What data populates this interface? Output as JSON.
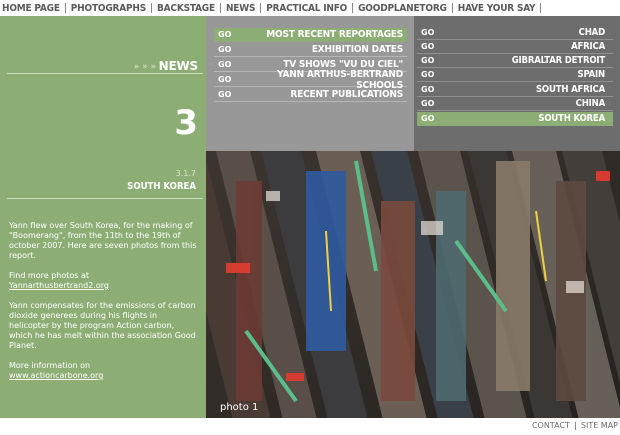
{
  "topnav": {
    "items": [
      {
        "label": "HOME PAGE"
      },
      {
        "label": "PHOTOGRAPHS"
      },
      {
        "label": "BACKSTAGE"
      },
      {
        "label": "NEWS"
      },
      {
        "label": "PRACTICAL INFO"
      },
      {
        "label": "GOODPLANETORG"
      },
      {
        "label": "HAVE YOUR SAY"
      }
    ]
  },
  "news": {
    "title": "NEWS",
    "arrows": "» » »",
    "number": "3"
  },
  "menu": {
    "go_label": "GO",
    "items": [
      {
        "label": "MOST RECENT REPORTAGES",
        "active": true
      },
      {
        "label": "EXHIBITION DATES",
        "active": false
      },
      {
        "label": "TV SHOWS \"VU DU CIEL\"",
        "active": false
      },
      {
        "label": "YANN ARTHUS-BERTRAND SCHOOLS",
        "active": false
      },
      {
        "label": "RECENT PUBLICATIONS",
        "active": false
      }
    ]
  },
  "countries": {
    "go_label": "GO",
    "items": [
      {
        "label": "CHAD",
        "active": false
      },
      {
        "label": "AFRICA",
        "active": false
      },
      {
        "label": "GIBRALTAR DETROIT",
        "active": false
      },
      {
        "label": "SPAIN",
        "active": false
      },
      {
        "label": "SOUTH AFRICA",
        "active": false
      },
      {
        "label": "CHINA",
        "active": false
      },
      {
        "label": "SOUTH KOREA",
        "active": true
      }
    ]
  },
  "article": {
    "number": "3.1.7",
    "title": "SOUTH KOREA",
    "p1": "Yann flew over South Korea, for the making of \"Boomerang\", from the 11th to the 19th of october 2007. Here are seven photos from this report.",
    "p2_text": "Find more photos at",
    "p2_link": "Yannarthusbertrand2.org",
    "p3": "Yann compensates for the emissions of carbon dioxide generees during his flights in helicopter by the program Action carbon, which he has melt within the association Good Planet.",
    "p4_text": "More information on",
    "p4_link": "www.actioncarbone.org"
  },
  "photo": {
    "caption": "photo 1"
  },
  "footer": {
    "contact": "CONTACT",
    "sitemap": "SITE MAP"
  },
  "colors": {
    "green": "#8cae74",
    "gray": "#989898",
    "dark_gray": "#6d6d6d"
  }
}
